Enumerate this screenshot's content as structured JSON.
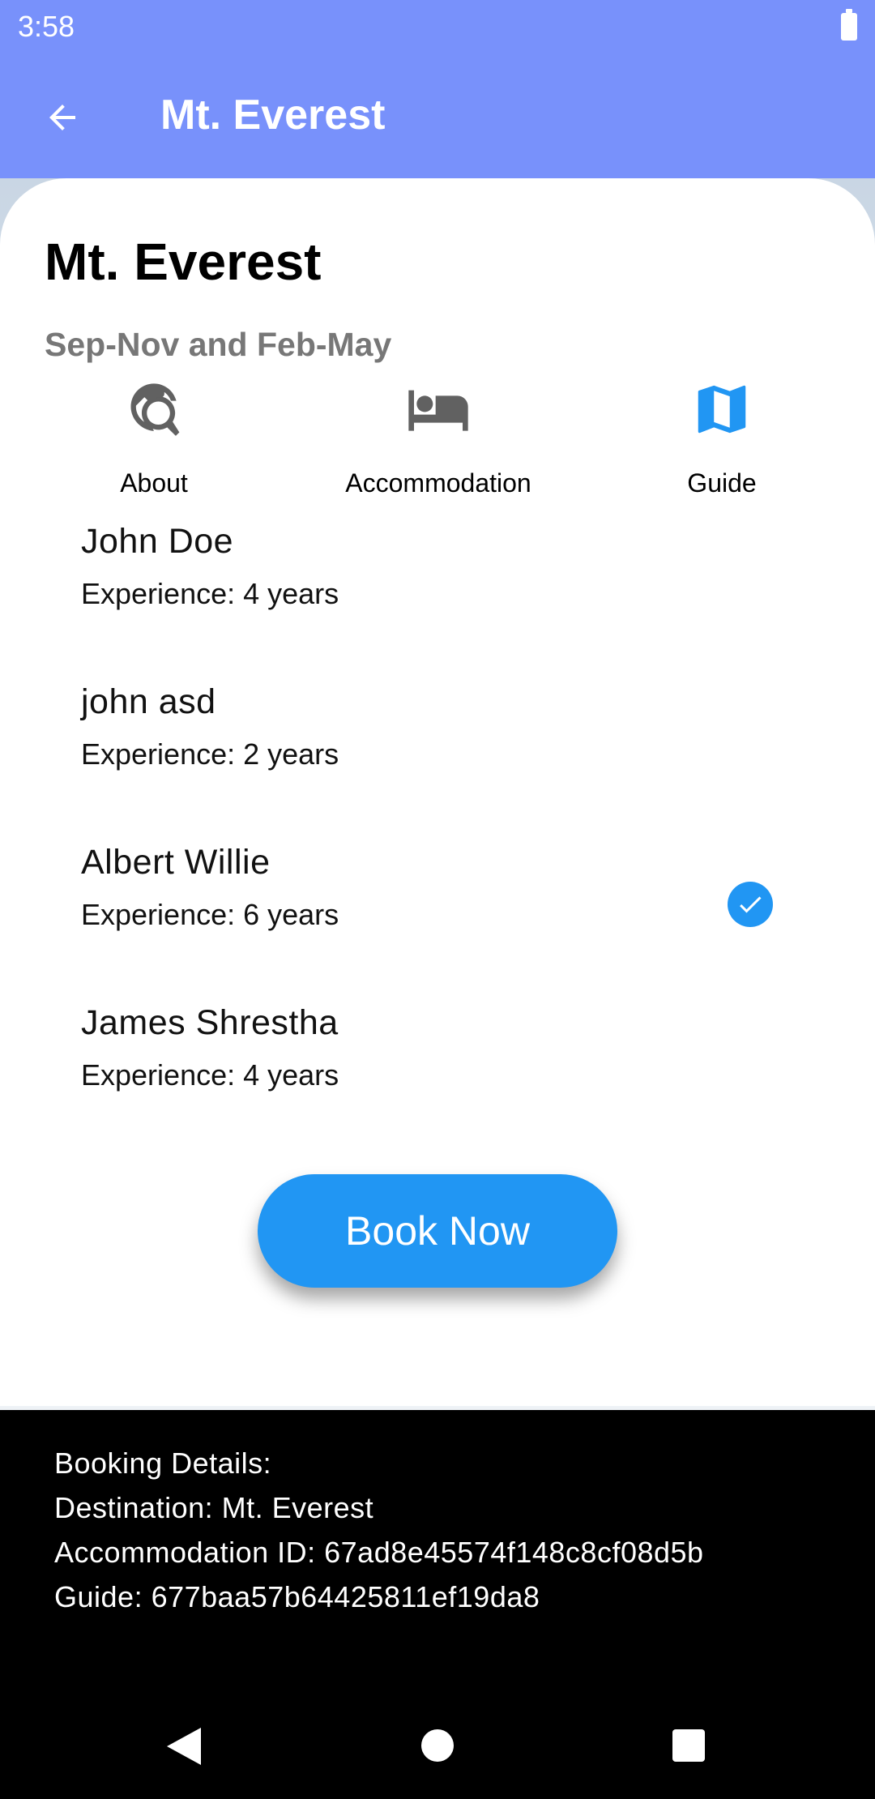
{
  "status": {
    "time": "3:58"
  },
  "app_bar": {
    "title": "Mt. Everest"
  },
  "card": {
    "title": "Mt. Everest",
    "season": "Sep-Nov and Feb-May"
  },
  "tabs": [
    {
      "label": "About",
      "icon": "travel-explore-icon",
      "active": false
    },
    {
      "label": "Accommodation",
      "icon": "hotel-bed-icon",
      "active": false
    },
    {
      "label": "Guide",
      "icon": "map-icon",
      "active": true
    }
  ],
  "guides": [
    {
      "name": "John Doe",
      "experience": "Experience: 4 years",
      "selected": false
    },
    {
      "name": "john asd",
      "experience": "Experience: 2 years",
      "selected": false
    },
    {
      "name": "Albert Willie",
      "experience": "Experience: 6 years",
      "selected": true
    },
    {
      "name": "James Shrestha",
      "experience": "Experience: 4 years",
      "selected": false
    }
  ],
  "book_button": {
    "label": "Book Now"
  },
  "booking_details": {
    "heading": "Booking Details:",
    "destination": "Destination: Mt. Everest",
    "accommodation": "Accommodation ID: 67ad8e45574f148c8cf08d5b",
    "guide": "Guide: 677baa57b64425811ef19da8"
  },
  "colors": {
    "app_bar": "#7891FB",
    "accent": "#2196F3",
    "inactive_icon": "#616161",
    "subtitle": "#777777"
  }
}
